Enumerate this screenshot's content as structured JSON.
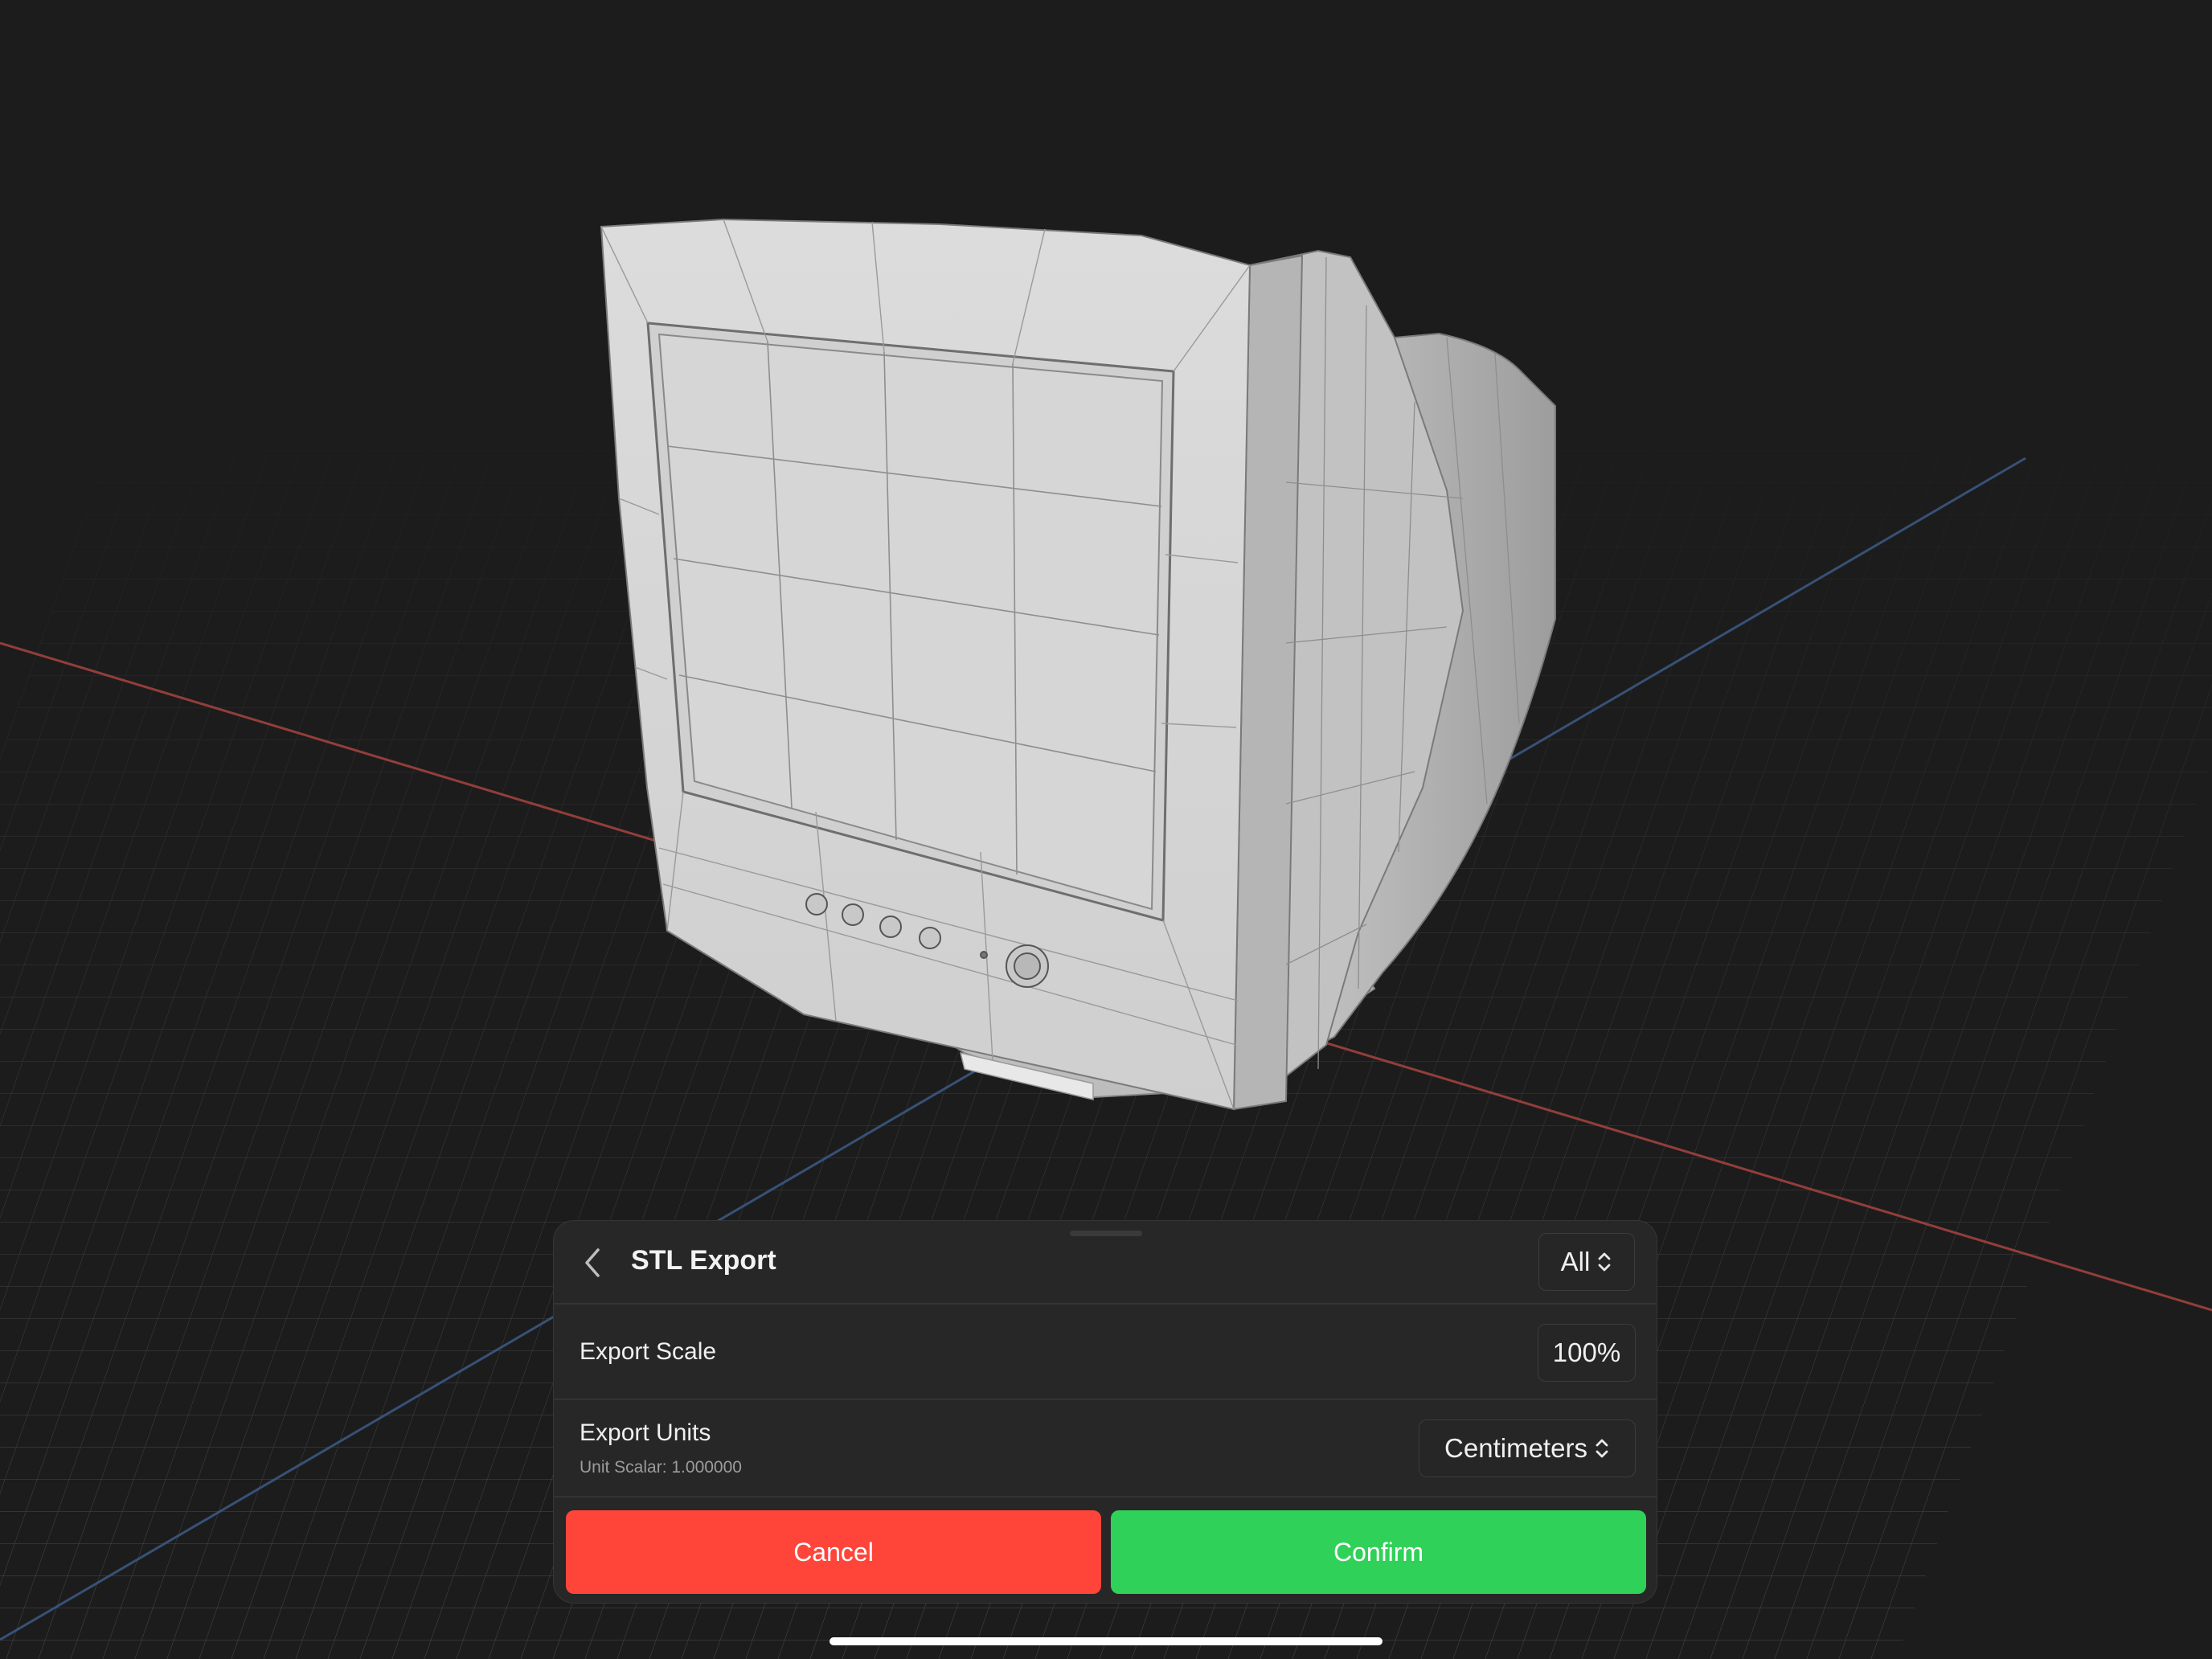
{
  "panel": {
    "title": "STL Export",
    "filter_value": "All",
    "rows": [
      {
        "label": "Export Scale",
        "value": "100%"
      },
      {
        "label": "Export Units",
        "sublabel": "Unit Scalar: 1.000000",
        "value": "Centimeters"
      }
    ],
    "cancel_label": "Cancel",
    "confirm_label": "Confirm"
  },
  "colors": {
    "cancel": "#ff453a",
    "confirm": "#30d158",
    "x_axis": "#a8453f",
    "z_axis": "#3c5b86",
    "background": "#1c1c1d"
  },
  "icons": [
    "back-chevron-icon",
    "up-down-chevron-icon"
  ]
}
